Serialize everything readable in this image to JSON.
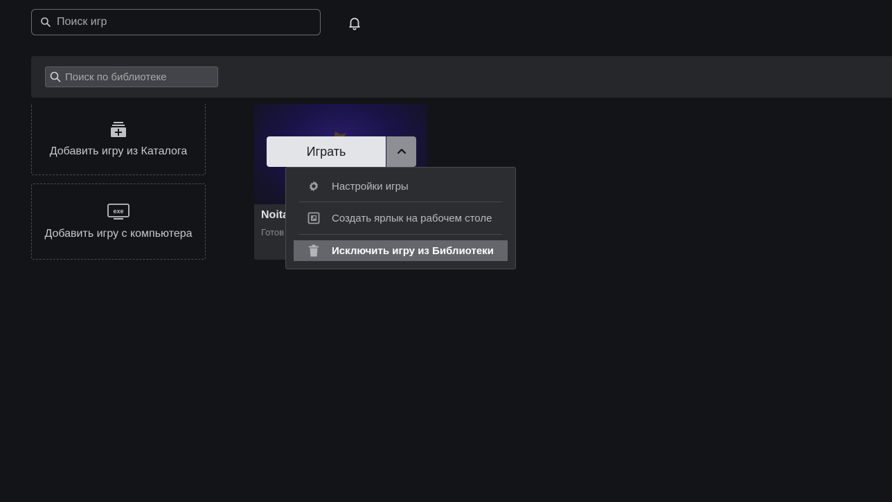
{
  "header": {
    "search_placeholder": "Поиск игр",
    "search_icon": "search-icon",
    "notifications_icon": "bell-icon"
  },
  "library": {
    "search_placeholder": "Поиск по библиотеке",
    "add_from_catalog": {
      "label": "Добавить игру из Каталога",
      "icon": "add-library-icon"
    },
    "add_from_computer": {
      "label": "Добавить игру с компьютера",
      "icon": "exe-icon",
      "icon_text": "exe"
    },
    "game": {
      "title": "Noita",
      "status": "Готов",
      "play_label": "Играть",
      "toggle_icon": "chevron-up-icon"
    }
  },
  "context_menu": {
    "items": [
      {
        "label": "Настройки игры",
        "icon": "gear-icon"
      },
      {
        "label": "Создать ярлык на рабочем столе",
        "icon": "shortcut-icon"
      },
      {
        "label": "Исключить игру из Библиотеки",
        "icon": "trash-icon",
        "highlighted": true
      }
    ]
  },
  "colors": {
    "background": "#131417",
    "panel": "#26272b",
    "play_button": "#e3e4e8",
    "menu_highlight": "#65666c"
  }
}
